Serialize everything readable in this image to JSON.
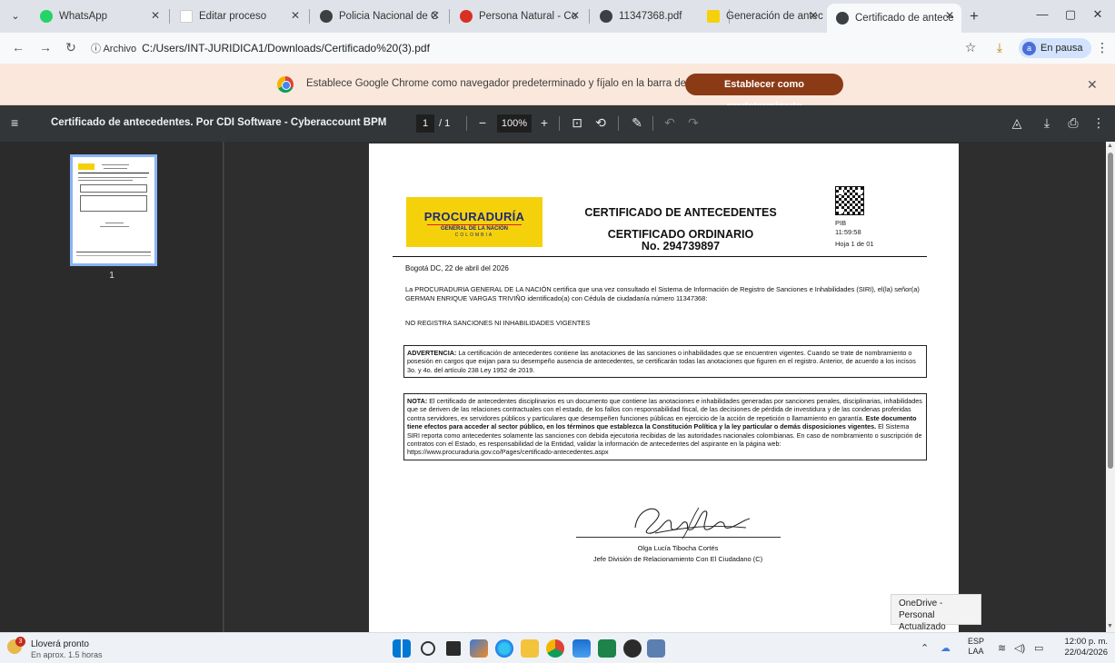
{
  "tabs": [
    {
      "title": "WhatsApp",
      "color": "#25d366"
    },
    {
      "title": "Editar proceso",
      "color": "#ffffff"
    },
    {
      "title": "Policia Nacional de C",
      "color": "#3c4043"
    },
    {
      "title": "Persona Natural - Co",
      "color": "#d93025"
    },
    {
      "title": "11347368.pdf",
      "color": "#3c4043"
    },
    {
      "title": "Generación de antec",
      "color": "#f5d10c"
    },
    {
      "title": "Certificado de antece",
      "color": "#3c4043"
    }
  ],
  "window": {
    "minimize": "—",
    "maximize": "▢",
    "close": "✕",
    "new_tab": "+",
    "tab_close": "✕"
  },
  "address": {
    "info_label": "ⓘ Archivo",
    "url": "C:/Users/INT-JURIDICA1/Downloads/Certificado%20(3).pdf",
    "profile_initial": "a",
    "profile_label": "En pausa"
  },
  "infobar": {
    "message": "Establece Google Chrome como navegador predeterminado y fíjalo en la barra de tareas",
    "button": "Establecer como predeterminado"
  },
  "pdf_toolbar": {
    "title": "Certificado de antecedentes. Por CDI Software - Cyberaccount BPM",
    "page": "1",
    "page_total": "/ 1",
    "zoom": "100%"
  },
  "sidebar": {
    "thumb_label": "1"
  },
  "document": {
    "logo_line1": "PROCURADURÍA",
    "logo_line2": "GENERAL DE LA NACIÓN",
    "logo_line3": "COLOMBIA",
    "title1": "CERTIFICADO DE ANTECEDENTES",
    "title2": "CERTIFICADO ORDINARIO",
    "number": "No. 294739897",
    "meta_code": "PIB",
    "meta_time": "11:59:58",
    "meta_page": "Hoja 1 de 01",
    "date": "Bogotá DC, 22 de abril del 2026",
    "body": "La PROCURADURIA GENERAL DE LA NACIÓN certifica que una vez consultado el Sistema de Información de Registro de Sanciones e Inhabilidades (SIRI), el(la) señor(a) GERMAN ENRIQUE VARGAS TRIVIÑO identificado(a) con Cédula de ciudadanía número 11347368:",
    "status": "NO REGISTRA SANCIONES NI INHABILIDADES VIGENTES",
    "warning_label": "ADVERTENCIA:",
    "warning_text": "La certificación de antecedentes contiene las anotaciones de las sanciones o inhabilidades que se encuentren vigentes. Cuando se trate de nombramiento o posesión en cargos que exijan para su desempeño ausencia de antecedentes, se certificarán todas las anotaciones que figuren en el registro. Anterior, de acuerdo a los incisos 3o. y 4o. del artículo 238 Ley 1952 de 2019.",
    "note_label": "NOTA:",
    "note_text1": "El certificado de antecedentes disciplinarios es un documento que contiene las anotaciones e inhabilidades generadas por sanciones penales, disciplinarias, inhabilidades que se deriven de las relaciones contractuales con el estado, de los fallos con responsabilidad fiscal, de las decisiones de pérdida de investidura y de las condenas proferidas contra servidores, ex servidores públicos y particulares que desempeñen funciones públicas en ejercicio de la acción de repetición o llamamiento en garantía.",
    "note_bold": "Este documento tiene efectos para acceder al sector público, en los términos que establezca la Constitución Política y la ley particular o demás disposiciones vigentes.",
    "note_text2": "El Sistema SIRI reporta como antecedentes solamente las sanciones con debida ejecutoria recibidas de las autoridades nacionales colombianas. En caso de nombramiento o suscripción de contratos con el Estado, es responsabilidad de la Entidad, validar la información de antecedentes del aspirante en la página web: https://www.procuraduria.gov.co/Pages/certificado-antecedentes.aspx",
    "signer_name": "Olga Lucía Tibocha Cortés",
    "signer_role": "Jefe División de Relacionamiento Con El Ciudadano (C)"
  },
  "toast": {
    "line1": "OneDrive - Personal",
    "line2": "Actualizado"
  },
  "taskbar": {
    "weather_badge": "3",
    "weather_title": "Lloverá pronto",
    "weather_sub": "En aprox. 1.5 horas",
    "lang1": "ESP",
    "lang2": "LAA",
    "time": "12:00 p. m.",
    "date": "22/04/2026"
  }
}
